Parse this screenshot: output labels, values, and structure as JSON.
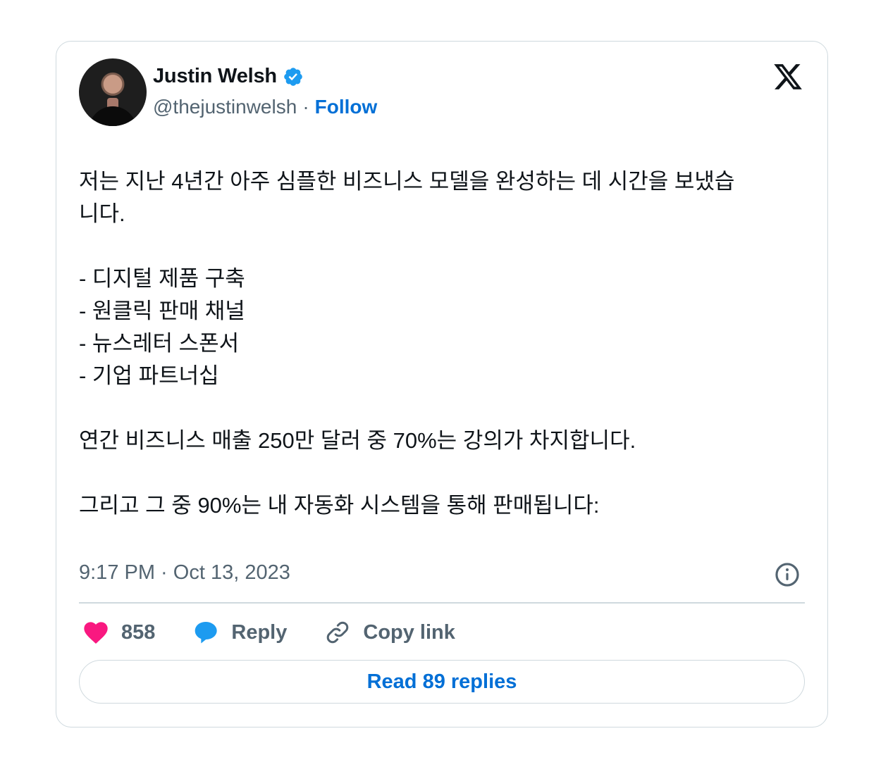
{
  "author": {
    "name": "Justin Welsh",
    "handle": "@thejustinwelsh",
    "separator": "·",
    "follow_label": "Follow"
  },
  "tweet": {
    "intro_line1": "저는 지난 4년간 아주 심플한 비즈니스 모델을 완성하는 데 시간을 보냈습",
    "intro_line2": "니다.",
    "bullets": [
      "- 디지털 제품 구축",
      "- 원클릭 판매 채널",
      "- 뉴스레터 스폰서",
      "- 기업 파트너십"
    ],
    "revenue_line": "연간 비즈니스 매출 250만 달러 중 70%는 강의가 차지합니다.",
    "closing_line": "그리고 그 중 90%는 내 자동화 시스템을 통해 판매됩니다:"
  },
  "timestamp": "9:17 PM · Oct 13, 2023",
  "actions": {
    "likes_count": "858",
    "reply_label": "Reply",
    "copy_link_label": "Copy link"
  },
  "read_replies_label": "Read 89 replies",
  "colors": {
    "accent": "#006fd6",
    "verified": "#1d9bf0",
    "like": "#f91880",
    "muted": "#536471",
    "border": "#cfd9de"
  },
  "icons": {
    "verified": "verified-badge-icon",
    "logo": "x-logo-icon",
    "info": "info-icon",
    "like": "heart-icon",
    "reply": "speech-bubble-icon",
    "copy": "link-icon"
  }
}
